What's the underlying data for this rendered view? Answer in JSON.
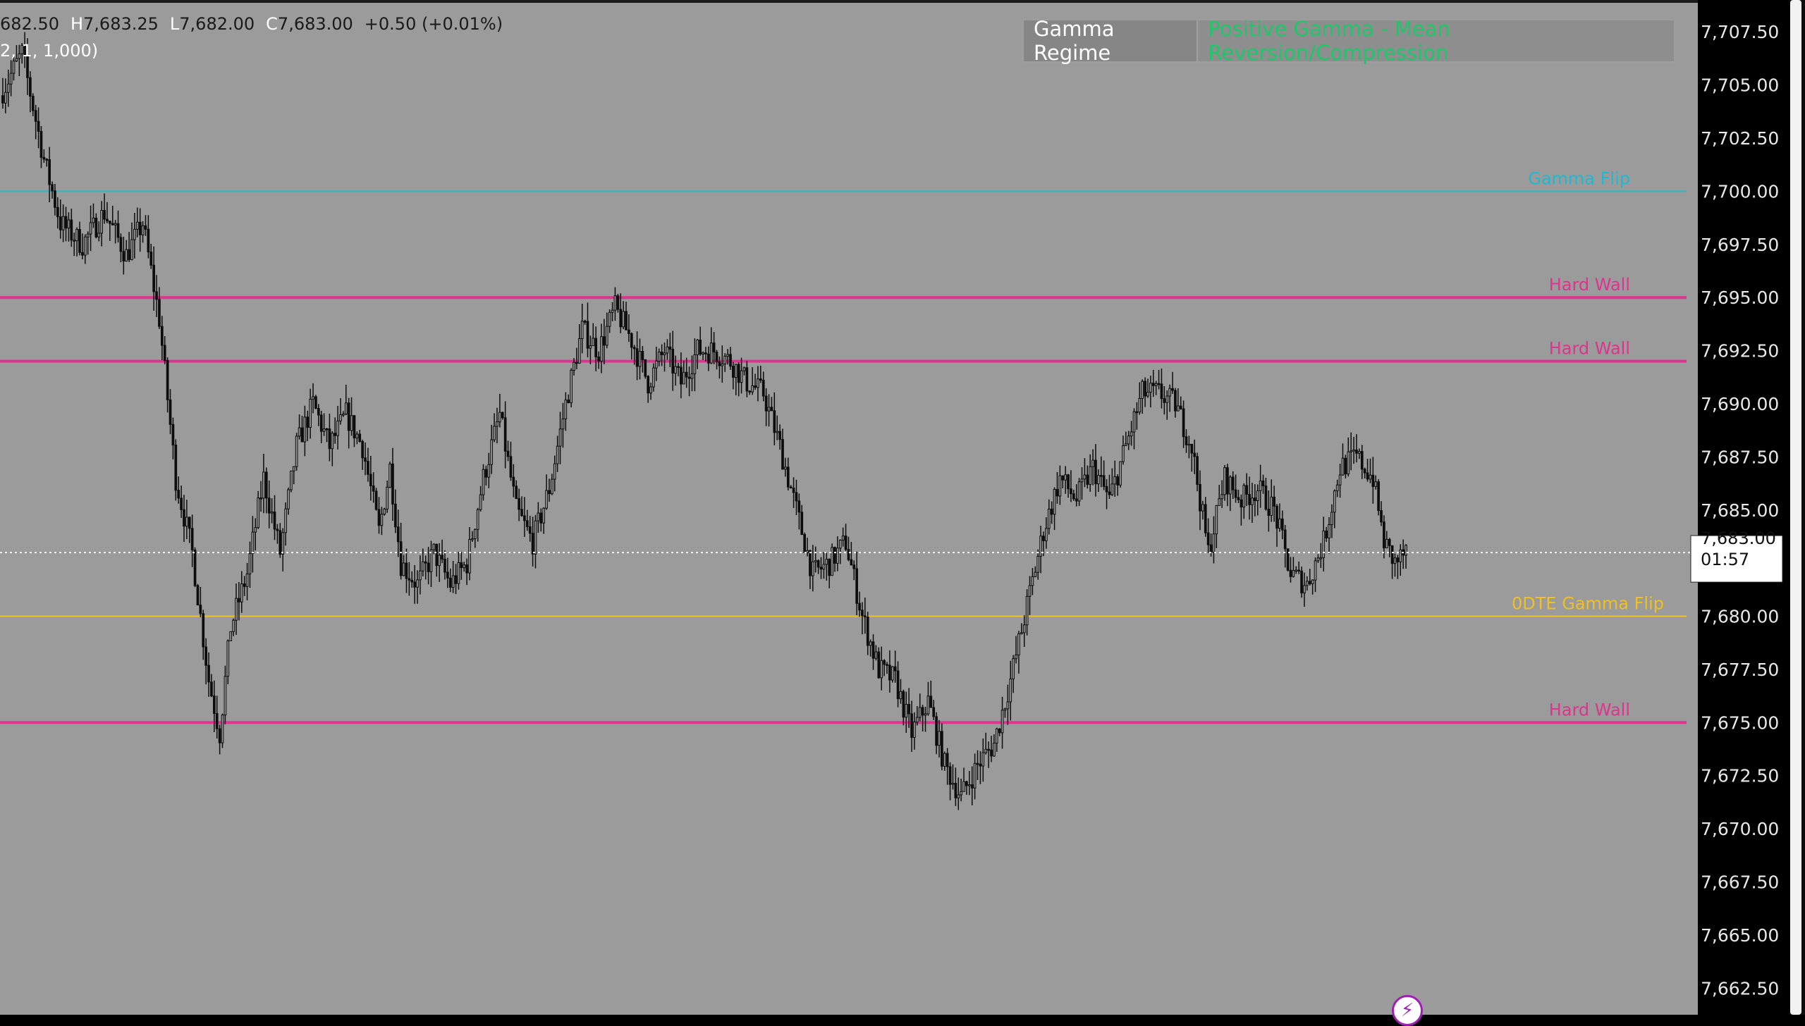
{
  "ohlc": {
    "open_value": "682.50",
    "high_label": "H",
    "high_value": "7,683.25",
    "low_label": "L",
    "low_value": "7,682.00",
    "close_label": "C",
    "close_value": "7,683.00",
    "change": "+0.50 (+0.01%)",
    "indicator_params": "2, 1, 1,000)"
  },
  "regime": {
    "label": "Gamma Regime",
    "value": "Positive Gamma - Mean Reversion/Compression"
  },
  "price_axis": {
    "ticks": [
      "7,707.50",
      "7,705.00",
      "7,702.50",
      "7,700.00",
      "7,697.50",
      "7,695.00",
      "7,692.50",
      "7,690.00",
      "7,687.50",
      "7,685.00",
      "7,683.00",
      "7,680.00",
      "7,677.50",
      "7,675.00",
      "7,672.50",
      "7,670.00",
      "7,667.50",
      "7,665.00",
      "7,662.50"
    ],
    "current_price": "7,683.00",
    "countdown": "01:57"
  },
  "colors": {
    "plot_bg": "#9b9b9b",
    "axis_bg": "#000000",
    "axis_text": "#e8e8e8",
    "gamma_flip": "#1fb9d0",
    "hard_wall": "#e0338f",
    "odte_flip": "#f0c020",
    "candle": "#0d0d0d",
    "current_line": "#f2f2f2"
  },
  "chart_data": {
    "type": "candlestick",
    "y_range": [
      7661.25,
      7709.0
    ],
    "levels": [
      {
        "name": "Gamma Flip",
        "price": 7700.0,
        "style": "gamma_flip"
      },
      {
        "name": "Hard Wall",
        "price": 7695.0,
        "style": "hard_wall"
      },
      {
        "name": "Hard Wall",
        "price": 7692.0,
        "style": "hard_wall"
      },
      {
        "name": "0DTE Gamma Flip",
        "price": 7680.0,
        "style": "odte_flip"
      },
      {
        "name": "Hard Wall",
        "price": 7675.0,
        "style": "hard_wall"
      }
    ],
    "current_price": 7683.0,
    "price_path": [
      [
        0,
        7704.5
      ],
      [
        8,
        7706.5
      ],
      [
        16,
        7701.5
      ],
      [
        22,
        7698.5
      ],
      [
        30,
        7697.5
      ],
      [
        38,
        7699.0
      ],
      [
        46,
        7697.0
      ],
      [
        52,
        7698.5
      ],
      [
        58,
        7694.0
      ],
      [
        64,
        7686.5
      ],
      [
        70,
        7683.0
      ],
      [
        76,
        7677.0
      ],
      [
        80,
        7674.5
      ],
      [
        84,
        7679.5
      ],
      [
        90,
        7682.0
      ],
      [
        96,
        7686.5
      ],
      [
        102,
        7683.0
      ],
      [
        108,
        7688.0
      ],
      [
        114,
        7690.0
      ],
      [
        120,
        7688.0
      ],
      [
        126,
        7689.5
      ],
      [
        132,
        7688.0
      ],
      [
        138,
        7684.0
      ],
      [
        142,
        7687.0
      ],
      [
        146,
        7682.5
      ],
      [
        152,
        7681.5
      ],
      [
        158,
        7683.0
      ],
      [
        164,
        7681.5
      ],
      [
        170,
        7682.5
      ],
      [
        176,
        7686.5
      ],
      [
        182,
        7689.5
      ],
      [
        188,
        7685.0
      ],
      [
        194,
        7683.5
      ],
      [
        200,
        7686.0
      ],
      [
        206,
        7690.0
      ],
      [
        212,
        7693.5
      ],
      [
        218,
        7692.5
      ],
      [
        224,
        7694.5
      ],
      [
        230,
        7693.0
      ],
      [
        236,
        7691.0
      ],
      [
        242,
        7692.5
      ],
      [
        248,
        7691.0
      ],
      [
        254,
        7692.5
      ],
      [
        260,
        7692.5
      ],
      [
        266,
        7692.0
      ],
      [
        272,
        7691.0
      ],
      [
        278,
        7690.5
      ],
      [
        284,
        7688.0
      ],
      [
        290,
        7685.0
      ],
      [
        296,
        7682.0
      ],
      [
        302,
        7682.5
      ],
      [
        308,
        7683.5
      ],
      [
        314,
        7680.0
      ],
      [
        320,
        7677.5
      ],
      [
        326,
        7677.0
      ],
      [
        332,
        7674.5
      ],
      [
        338,
        7676.0
      ],
      [
        344,
        7673.0
      ],
      [
        350,
        7671.5
      ],
      [
        356,
        7673.0
      ],
      [
        362,
        7674.0
      ],
      [
        368,
        7677.0
      ],
      [
        374,
        7680.5
      ],
      [
        380,
        7684.0
      ],
      [
        386,
        7686.5
      ],
      [
        392,
        7685.5
      ],
      [
        398,
        7687.0
      ],
      [
        404,
        7685.5
      ],
      [
        410,
        7688.0
      ],
      [
        416,
        7690.5
      ],
      [
        422,
        7690.5
      ],
      [
        428,
        7690.0
      ],
      [
        434,
        7688.0
      ],
      [
        440,
        7683.0
      ],
      [
        446,
        7686.5
      ],
      [
        452,
        7685.5
      ],
      [
        458,
        7686.0
      ],
      [
        464,
        7685.0
      ],
      [
        470,
        7682.0
      ],
      [
        476,
        7681.5
      ],
      [
        482,
        7683.5
      ],
      [
        488,
        7687.0
      ],
      [
        494,
        7687.5
      ],
      [
        500,
        7686.5
      ],
      [
        504,
        7683.5
      ],
      [
        508,
        7682.5
      ],
      [
        512,
        7683.0
      ]
    ]
  }
}
